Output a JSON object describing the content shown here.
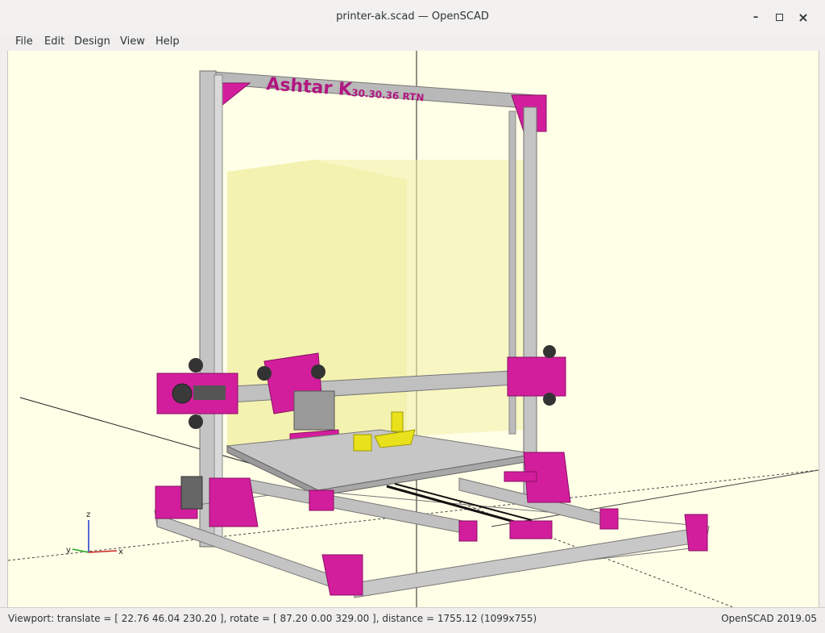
{
  "window": {
    "title": "printer-ak.scad — OpenSCAD",
    "controls": {
      "minimize": "–",
      "maximize": "□",
      "close": "×"
    }
  },
  "menu": [
    "File",
    "Edit",
    "Design",
    "View",
    "Help"
  ],
  "viewport": {
    "model_text_main": "Ashtar K",
    "model_text_sub": "30.30.36 RTN",
    "axis_labels": {
      "x": "x",
      "y": "y",
      "z": "z"
    },
    "colors": {
      "background": "#fffee7",
      "frame": "#c7c7c7",
      "parts": "#d21e9c",
      "print_object": "#e9e11b",
      "build_volume": "#f2f0a0"
    }
  },
  "status": {
    "viewport_info": "Viewport: translate = [ 22.76 46.04 230.20 ], rotate = [ 87.20 0.00 329.00 ], distance = 1755.12 (1099x755)",
    "version": "OpenSCAD 2019.05"
  }
}
